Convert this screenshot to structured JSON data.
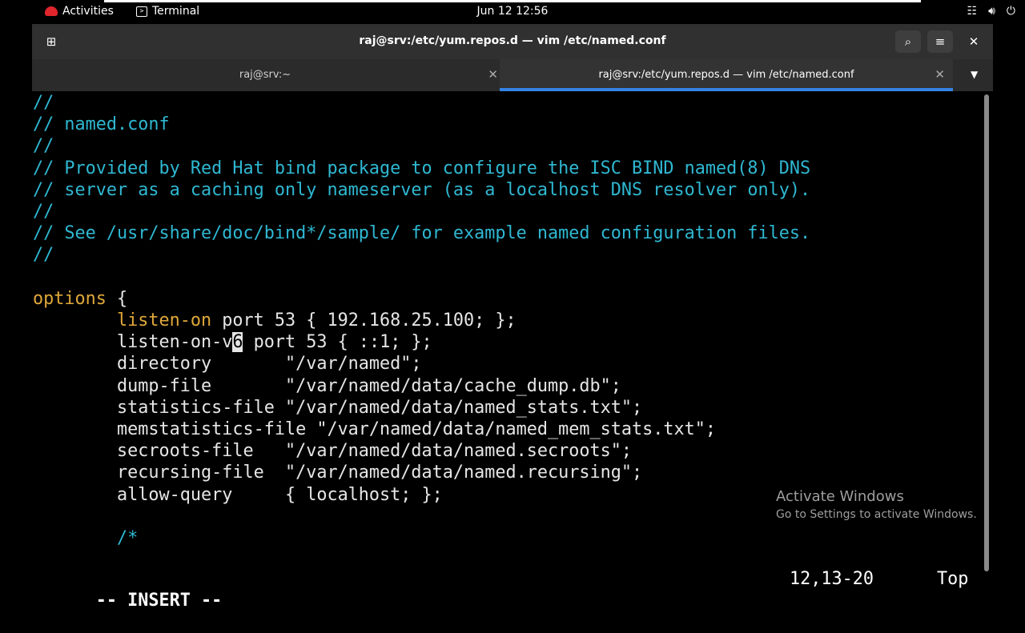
{
  "topbar": {
    "activities": "Activities",
    "app_name": "Terminal",
    "clock": "Jun 12  12:56",
    "icons": [
      "network-icon",
      "volume-icon",
      "power-icon"
    ]
  },
  "window": {
    "title": "raj@srv:/etc/yum.repos.d — vim /etc/named.conf",
    "icons": [
      "new-tab-icon",
      "search-icon",
      "hamburger-menu-icon",
      "close-icon"
    ]
  },
  "tabs": [
    {
      "label": "raj@srv:~",
      "active": false
    },
    {
      "label": "raj@srv:/etc/yum.repos.d — vim /etc/named.conf",
      "active": true
    }
  ],
  "editor": {
    "lines": [
      {
        "comment": "//"
      },
      {
        "comment": "// named.conf"
      },
      {
        "comment": "//"
      },
      {
        "comment": "// Provided by Red Hat bind package to configure the ISC BIND named(8) DNS"
      },
      {
        "comment": "// server as a caching only nameserver (as a localhost DNS resolver only)."
      },
      {
        "comment": "//"
      },
      {
        "comment": "// See /usr/share/doc/bind*/sample/ for example named configuration files."
      },
      {
        "comment": "//"
      },
      {
        "text": ""
      },
      {
        "keyword": "options",
        "text": " {"
      },
      {
        "indent": "        ",
        "keyword": "listen-on",
        "text": " port 53 { 192.168.25.100; };"
      },
      {
        "indent": "        ",
        "pre": "listen-on-v",
        "cursor": "6",
        "text": " port 53 { ::1; };"
      },
      {
        "indent": "        ",
        "text": "directory       \"/var/named\";"
      },
      {
        "indent": "        ",
        "text": "dump-file       \"/var/named/data/cache_dump.db\";"
      },
      {
        "indent": "        ",
        "text": "statistics-file \"/var/named/data/named_stats.txt\";"
      },
      {
        "indent": "        ",
        "text": "memstatistics-file \"/var/named/data/named_mem_stats.txt\";"
      },
      {
        "indent": "        ",
        "text": "secroots-file   \"/var/named/data/named.secroots\";"
      },
      {
        "indent": "        ",
        "text": "recursing-file  \"/var/named/data/named.recursing\";"
      },
      {
        "indent": "        ",
        "text": "allow-query     { localhost; };"
      },
      {
        "text": ""
      },
      {
        "indent": "        ",
        "comment": "/*"
      }
    ]
  },
  "statusline": {
    "mode": "-- INSERT --",
    "position": "12,13-20",
    "scroll": "Top"
  },
  "watermark": {
    "title": "Activate Windows",
    "subtitle": "Go to Settings to activate Windows."
  },
  "colors": {
    "comment": "#2fb8d2",
    "keyword": "#e0a83a",
    "accent": "#3584e4"
  }
}
